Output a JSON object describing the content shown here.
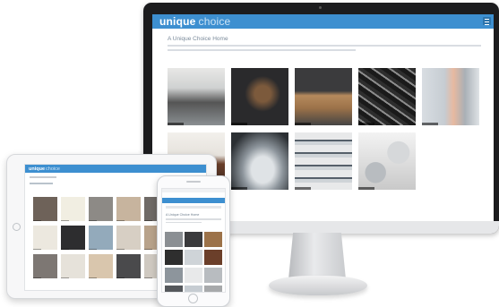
{
  "desktop": {
    "brand": "unique",
    "brand_suffix": "choice",
    "page_title": "A Unique Choice Home",
    "tiles": [
      {
        "name": "kitchen-interior-tile",
        "cls": "t1"
      },
      {
        "name": "drawer-organizer-tile",
        "cls": "t2"
      },
      {
        "name": "worktop-tile",
        "cls": "t3"
      },
      {
        "name": "cutlery-insert-tile",
        "cls": "t4"
      },
      {
        "name": "wall-cabinet-tile",
        "cls": "t5"
      },
      {
        "name": "kitchen-wall-tile",
        "cls": "t6"
      },
      {
        "name": "sink-tile",
        "cls": "t7"
      },
      {
        "name": "shelving-tile",
        "cls": "t8"
      },
      {
        "name": "waste-bins-tile",
        "cls": "t9"
      }
    ]
  },
  "tablet": {
    "brand": "unique",
    "brand_suffix": "choice",
    "swatch_colors": [
      "#6e6259",
      "#f1eee2",
      "#8d8a86",
      "#c7b49e",
      "#6f6a66",
      "#ece8df",
      "#2d2d2f",
      "#93aabb",
      "#d7cfc4",
      "#b8a28a",
      "#7d7773",
      "#e6e2da",
      "#d9c6ad",
      "#4a4a4c",
      "#cfc9c1"
    ]
  },
  "phone": {
    "page_title": "A Unique Choice Home",
    "thumb_colors": [
      "#8b8f93",
      "#3a3a3c",
      "#9c7249",
      "#2e2e2e",
      "#cfd4d8",
      "#6b3f2a",
      "#8d959c",
      "#e8e9ea",
      "#b8bcc0",
      "#55585c",
      "#c6ccd2",
      "#a7a9ab"
    ]
  }
}
